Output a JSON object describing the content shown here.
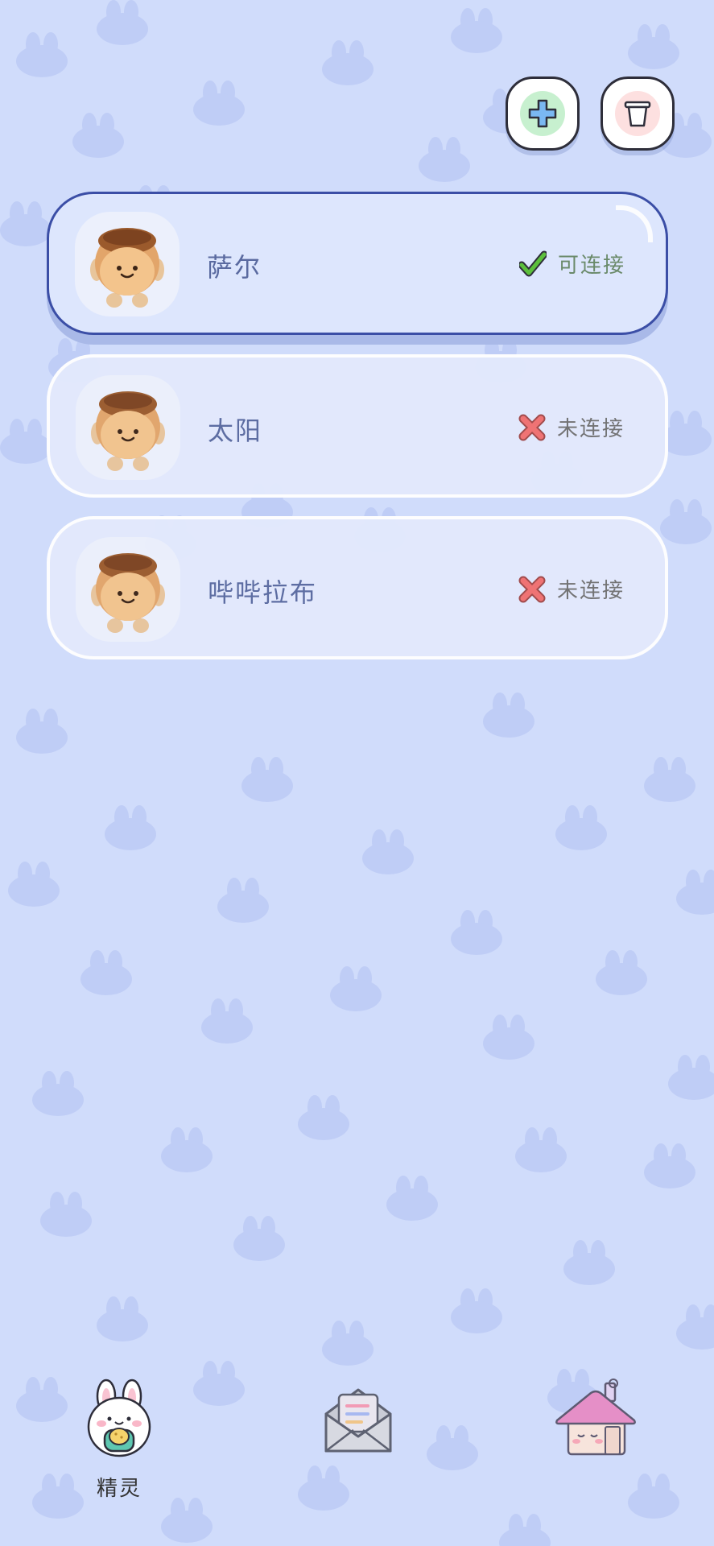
{
  "toolbar": {
    "add_icon": "plus-icon",
    "delete_icon": "trash-icon"
  },
  "sprites": [
    {
      "name": "萨尔",
      "status": "可连接",
      "status_icon": "check-icon",
      "active": true
    },
    {
      "name": "太阳",
      "status": "未连接",
      "status_icon": "cross-icon",
      "active": false
    },
    {
      "name": "哔哔拉布",
      "status": "未连接",
      "status_icon": "cross-icon",
      "active": false
    }
  ],
  "bottom_nav": {
    "items": [
      {
        "label": "精灵",
        "icon": "bunny-sprite-icon",
        "selected": true
      },
      {
        "label": "",
        "icon": "mail-envelope-icon",
        "selected": false
      },
      {
        "label": "",
        "icon": "house-icon",
        "selected": false
      }
    ]
  },
  "colors": {
    "background": "#d0dcfb",
    "active_border": "#3b4ea6",
    "check_green": "#5cbf3c",
    "cross_red": "#f07070"
  }
}
